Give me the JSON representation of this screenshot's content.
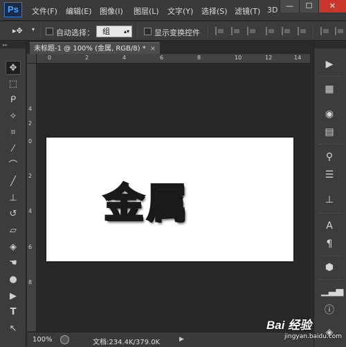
{
  "app": {
    "logo": "Ps"
  },
  "menubar": {
    "items": [
      "文件(F)",
      "编辑(E)",
      "图像(I)",
      "图层(L)",
      "文字(Y)",
      "选择(S)",
      "滤镜(T)",
      "3D"
    ]
  },
  "window_controls": {
    "minimize": "—",
    "maximize": "☐",
    "close": "✕"
  },
  "options_bar": {
    "tool_glyph": "▸✥",
    "auto_select_label": "自动选择：",
    "auto_select_value": "组",
    "show_transform_label": "显示变换控件"
  },
  "document": {
    "tab_title": "未标题-1 @ 100% (金属, RGB/8) *",
    "close_glyph": "×",
    "canvas_text": "金属"
  },
  "rulers": {
    "top_labels": [
      "0",
      "2",
      "4",
      "6",
      "8",
      "10",
      "12",
      "14"
    ],
    "left_labels": [
      "4",
      "2",
      "0",
      "2",
      "4",
      "6",
      "8"
    ]
  },
  "status_bar": {
    "zoom": "100%",
    "doc_size": "文档:234.4K/379.0K",
    "arrow": "▶"
  },
  "toolbox": {
    "tools": [
      "move-tool",
      "marquee-tool",
      "lasso-tool",
      "magic-wand-tool",
      "crop-tool",
      "eyedropper-tool",
      "healing-brush-tool",
      "brush-tool",
      "clone-stamp-tool",
      "history-brush-tool",
      "eraser-tool",
      "paint-bucket-tool",
      "smudge-tool",
      "dodge-tool",
      "path-selection-tool",
      "type-tool",
      "direct-selection-tool"
    ]
  },
  "watermark": {
    "brand": "Bai 经验",
    "url": "jingyan.baidu.com"
  }
}
